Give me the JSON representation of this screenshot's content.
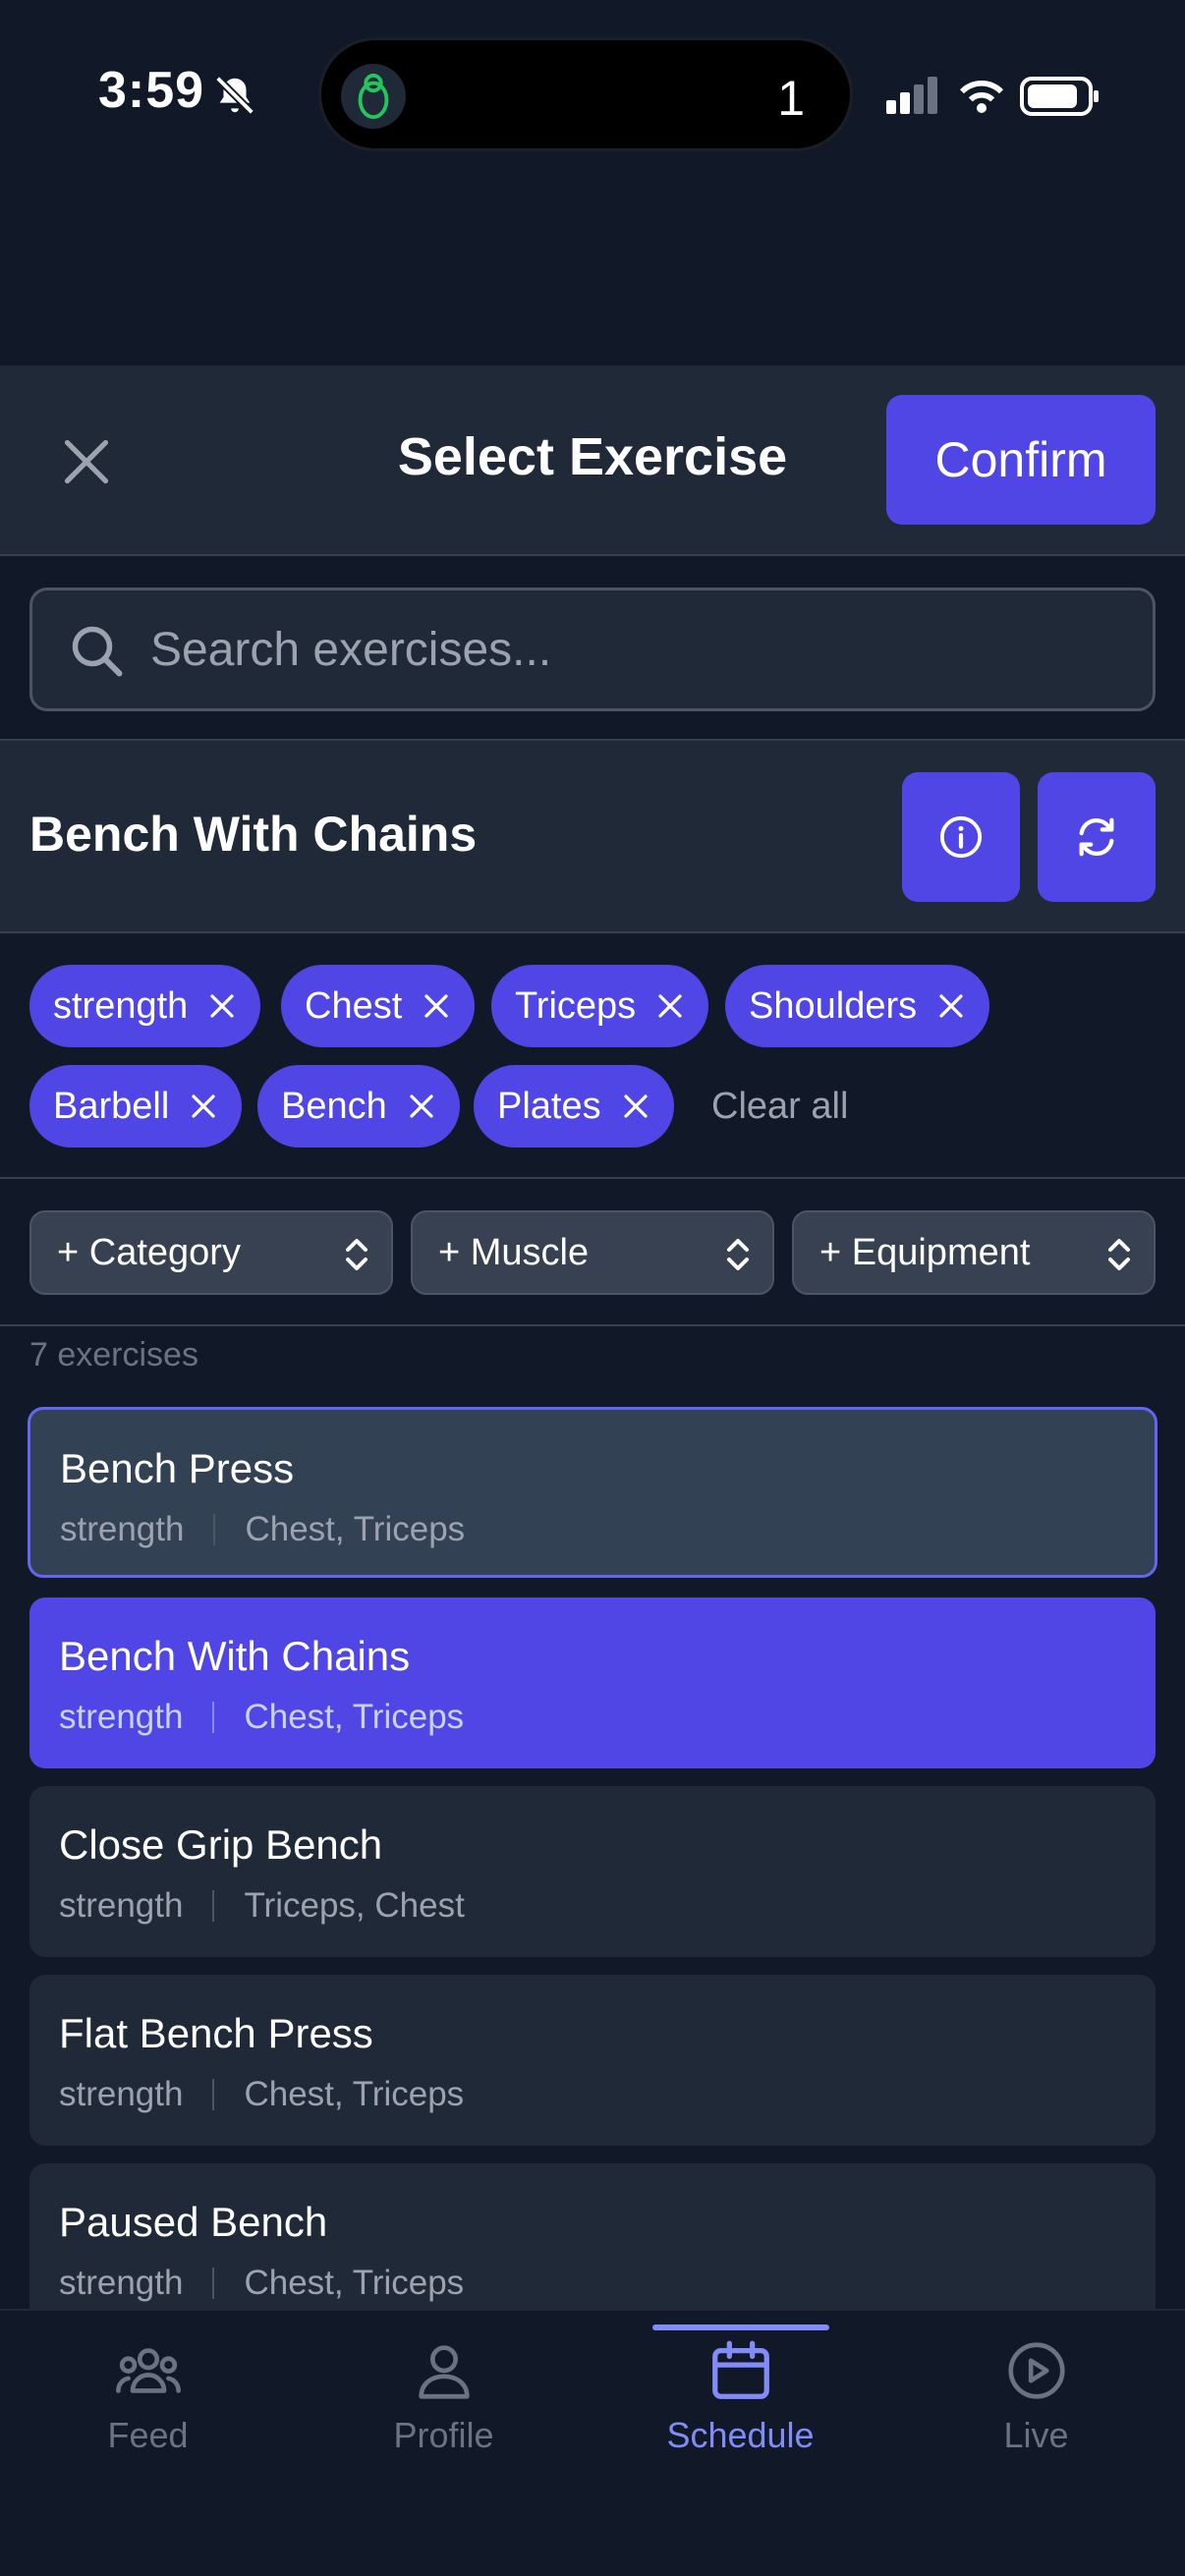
{
  "status_bar": {
    "time": "3:59",
    "island_count": "1"
  },
  "header": {
    "title": "Select Exercise",
    "confirm_label": "Confirm"
  },
  "search": {
    "placeholder": "Search exercises..."
  },
  "selected": {
    "name": "Bench With Chains"
  },
  "chips": [
    {
      "label": "strength"
    },
    {
      "label": "Chest"
    },
    {
      "label": "Triceps"
    },
    {
      "label": "Shoulders"
    },
    {
      "label": "Barbell"
    },
    {
      "label": "Bench"
    },
    {
      "label": "Plates"
    }
  ],
  "clear_all_label": "Clear all",
  "filters": [
    {
      "label": "+ Category"
    },
    {
      "label": "+ Muscle"
    },
    {
      "label": "+ Equipment"
    }
  ],
  "count_text": "7 exercises",
  "exercises": [
    {
      "name": "Bench Press",
      "category": "strength",
      "muscles": "Chest, Triceps",
      "state": "highlighted"
    },
    {
      "name": "Bench With Chains",
      "category": "strength",
      "muscles": "Chest, Triceps",
      "state": "selected"
    },
    {
      "name": "Close Grip Bench",
      "category": "strength",
      "muscles": "Triceps, Chest",
      "state": "normal"
    },
    {
      "name": "Flat Bench Press",
      "category": "strength",
      "muscles": "Chest, Triceps",
      "state": "normal"
    },
    {
      "name": "Paused Bench",
      "category": "strength",
      "muscles": "Chest, Triceps",
      "state": "normal"
    }
  ],
  "nav": [
    {
      "label": "Feed",
      "icon": "users-icon"
    },
    {
      "label": "Profile",
      "icon": "user-icon"
    },
    {
      "label": "Schedule",
      "icon": "calendar-icon",
      "active": true
    },
    {
      "label": "Live",
      "icon": "play-circle-icon"
    }
  ],
  "colors": {
    "accent": "#4f46e5",
    "accent_light": "#818cf8",
    "background": "#111827",
    "surface": "#1f2937"
  }
}
